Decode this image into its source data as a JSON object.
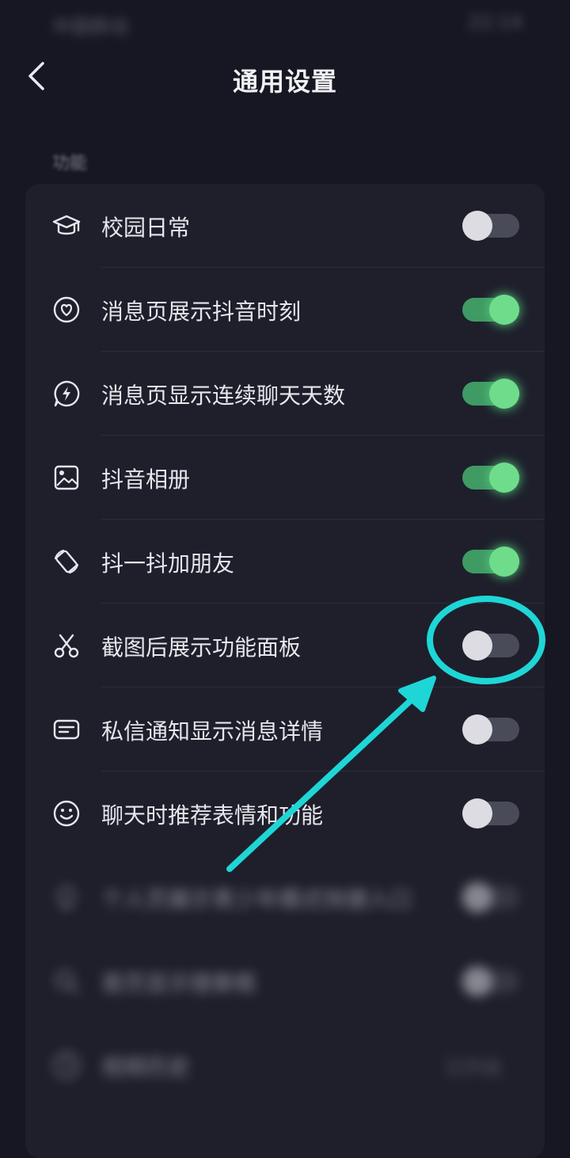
{
  "status_bar": {
    "carrier": "中国移动",
    "time": "22:14"
  },
  "header": {
    "title": "通用设置"
  },
  "section": {
    "label": "功能"
  },
  "rows": [
    {
      "label": "校园日常",
      "icon": "graduation-cap-icon",
      "state": "off"
    },
    {
      "label": "消息页展示抖音时刻",
      "icon": "heart-circle-icon",
      "state": "on"
    },
    {
      "label": "消息页显示连续聊天天数",
      "icon": "lightning-bubble-icon",
      "state": "on"
    },
    {
      "label": "抖音相册",
      "icon": "image-icon",
      "state": "on"
    },
    {
      "label": "抖一抖加朋友",
      "icon": "shake-phone-icon",
      "state": "on"
    },
    {
      "label": "截图后展示功能面板",
      "icon": "scissors-icon",
      "state": "off"
    },
    {
      "label": "私信通知显示消息详情",
      "icon": "message-card-icon",
      "state": "off"
    },
    {
      "label": "聊天时推荐表情和功能",
      "icon": "smile-icon",
      "state": "off"
    }
  ],
  "blurred_rows": [
    {
      "label": "个人页展示青少年模式快捷入口",
      "icon": "lightbulb-icon",
      "state": "off"
    },
    {
      "label": "首页显示搜索框",
      "icon": "search-icon",
      "state": "off"
    },
    {
      "label": "视频历史",
      "icon": "clock-icon",
      "value": "已开启"
    }
  ],
  "colors": {
    "background": "#161722",
    "card": "#1e1f2b",
    "toggle_on": "#6fdc8c",
    "annotation": "#1fd6d6"
  }
}
